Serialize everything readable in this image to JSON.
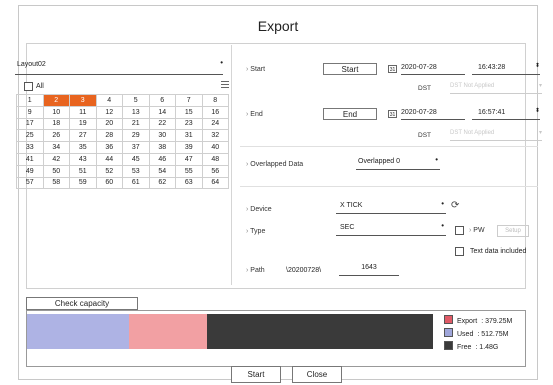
{
  "dialog": {
    "title": "Export"
  },
  "layout": {
    "value": "Layout02",
    "all_label": "All"
  },
  "channels": [
    [
      "1",
      "2",
      "3",
      "4",
      "5",
      "6",
      "7",
      "8"
    ],
    [
      "9",
      "10",
      "11",
      "12",
      "13",
      "14",
      "15",
      "16"
    ],
    [
      "17",
      "18",
      "19",
      "20",
      "21",
      "22",
      "23",
      "24"
    ],
    [
      "25",
      "26",
      "27",
      "28",
      "29",
      "30",
      "31",
      "32"
    ],
    [
      "33",
      "34",
      "35",
      "36",
      "37",
      "38",
      "39",
      "40"
    ],
    [
      "41",
      "42",
      "43",
      "44",
      "45",
      "46",
      "47",
      "48"
    ],
    [
      "49",
      "50",
      "51",
      "52",
      "53",
      "54",
      "55",
      "56"
    ],
    [
      "57",
      "58",
      "59",
      "60",
      "61",
      "62",
      "63",
      "64"
    ]
  ],
  "selected_channels": [
    "2",
    "3"
  ],
  "start": {
    "label": "Start",
    "button": "Start",
    "date": "2020-07-28",
    "time": "16:43:28",
    "dst_label": "DST",
    "dst_value": "DST Not Applied"
  },
  "end": {
    "label": "End",
    "button": "End",
    "date": "2020-07-28",
    "time": "16:57:41",
    "dst_label": "DST",
    "dst_value": "DST Not Applied"
  },
  "overlapped": {
    "label": "Overlapped Data",
    "value": "Overlapped 0"
  },
  "device": {
    "label": "Device",
    "value": "X TICK"
  },
  "type": {
    "label": "Type",
    "value": "SEC",
    "pw_label": "PW",
    "setup_label": "Setup",
    "text_data_label": "Text data included"
  },
  "path": {
    "label": "Path",
    "prefix": "\\20200728\\",
    "value": "1643"
  },
  "capacity": {
    "button": "Check capacity",
    "legend": [
      {
        "name": "Export",
        "value": ": 379.25M",
        "color": "#e05a66"
      },
      {
        "name": "Used",
        "value": ": 512.75M",
        "color": "#9fa6da"
      },
      {
        "name": "Free",
        "value": ": 1.48G",
        "color": "#3a3a3a"
      }
    ],
    "bar_colors": {
      "used": "#aeb3e4",
      "export": "#f2a0a3",
      "free": "#3a3a3a"
    }
  },
  "footer": {
    "start": "Start",
    "close": "Close"
  }
}
